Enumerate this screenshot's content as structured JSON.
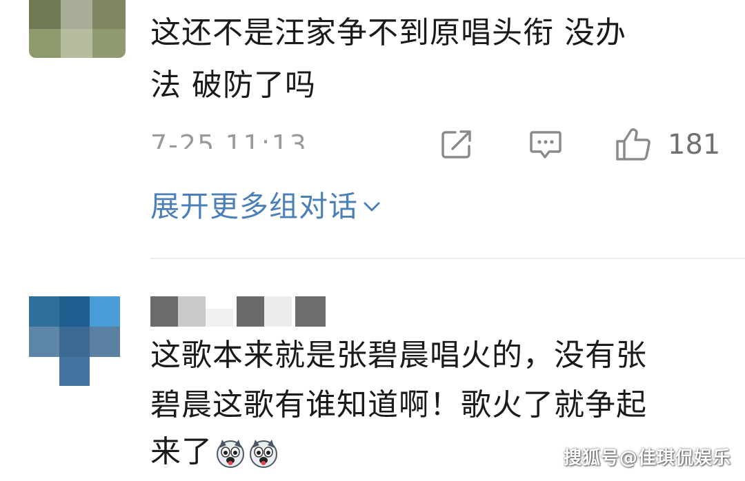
{
  "comment1": {
    "line1": "这还不是汪家争不到原唱头衔 没办",
    "line2": "法 破防了吗",
    "timestamp": "7-25 11:13",
    "like_count": "181",
    "icons": [
      "share-icon",
      "reply-icon",
      "like-icon"
    ]
  },
  "expand": {
    "label": "展开更多组对话",
    "icon": "chevron-down-icon"
  },
  "comment2": {
    "line1": "这歌本来就是张碧晨唱火的，没有张",
    "line2": "碧晨这歌有谁知道啊！歌火了就争起",
    "line3": "来了",
    "emoji": "husky-emoji"
  },
  "watermark": "搜狐号@佳琪侃娱乐",
  "colors": {
    "text": "#1a1a1a",
    "meta": "#9a9a9a",
    "link": "#4a7fb8",
    "icon": "#8a8a8a"
  }
}
